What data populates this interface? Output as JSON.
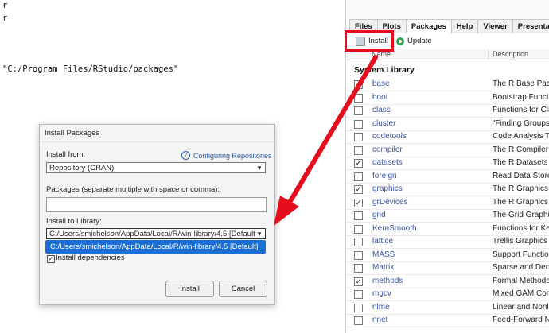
{
  "editor": {
    "lines": [
      "r",
      "r",
      "\"C:/Program Files/RStudio/packages\""
    ]
  },
  "pane": {
    "tabs": [
      "Files",
      "Plots",
      "Packages",
      "Help",
      "Viewer",
      "Presentation"
    ],
    "active_tab": "Packages",
    "toolbar": {
      "install_label": "Install",
      "update_label": "Update"
    },
    "columns": {
      "name": "Name",
      "description": "Description"
    },
    "section_label": "System Library",
    "packages": [
      {
        "name": "base",
        "desc": "The R Base Package",
        "checked": true
      },
      {
        "name": "boot",
        "desc": "Bootstrap Functions",
        "checked": false
      },
      {
        "name": "class",
        "desc": "Functions for Classification",
        "checked": false
      },
      {
        "name": "cluster",
        "desc": "\"Finding Groups in Data\"",
        "checked": false
      },
      {
        "name": "codetools",
        "desc": "Code Analysis Tools",
        "checked": false
      },
      {
        "name": "compiler",
        "desc": "The R Compiler Package",
        "checked": false
      },
      {
        "name": "datasets",
        "desc": "The R Datasets Package",
        "checked": true
      },
      {
        "name": "foreign",
        "desc": "Read Data Stored",
        "checked": false
      },
      {
        "name": "graphics",
        "desc": "The R Graphics Package",
        "checked": true
      },
      {
        "name": "grDevices",
        "desc": "The R Graphics Devices",
        "checked": true
      },
      {
        "name": "grid",
        "desc": "The Grid Graphics",
        "checked": false
      },
      {
        "name": "KernSmooth",
        "desc": "Functions for Kernel",
        "checked": false
      },
      {
        "name": "lattice",
        "desc": "Trellis Graphics for R",
        "checked": false
      },
      {
        "name": "MASS",
        "desc": "Support Functions",
        "checked": false
      },
      {
        "name": "Matrix",
        "desc": "Sparse and Dense",
        "checked": false
      },
      {
        "name": "methods",
        "desc": "Formal Methods and",
        "checked": true
      },
      {
        "name": "mgcv",
        "desc": "Mixed GAM Computation",
        "checked": false
      },
      {
        "name": "nlme",
        "desc": "Linear and Nonlinear",
        "checked": false
      },
      {
        "name": "nnet",
        "desc": "Feed-Forward Neural",
        "checked": false
      }
    ]
  },
  "dialog": {
    "title": "Install Packages",
    "install_from_label": "Install from:",
    "help_link": "Configuring Repositories",
    "install_from_value": "Repository (CRAN)",
    "packages_label": "Packages (separate multiple with space or comma):",
    "packages_value": "",
    "library_label": "Install to Library:",
    "library_value": "C:/Users/smichelson/AppData/Local/R/win-library/4.5 [Default",
    "dropdown_option": "C:/Users/smichelson/AppData/Local/R/win-library/4.5 [Default]",
    "dependencies_label": "Install dependencies",
    "install_button": "Install",
    "cancel_button": "Cancel"
  },
  "colors": {
    "highlight_red": "#e30d1b",
    "selection_blue": "#1a6fd6",
    "link_blue": "#3c55a5"
  }
}
